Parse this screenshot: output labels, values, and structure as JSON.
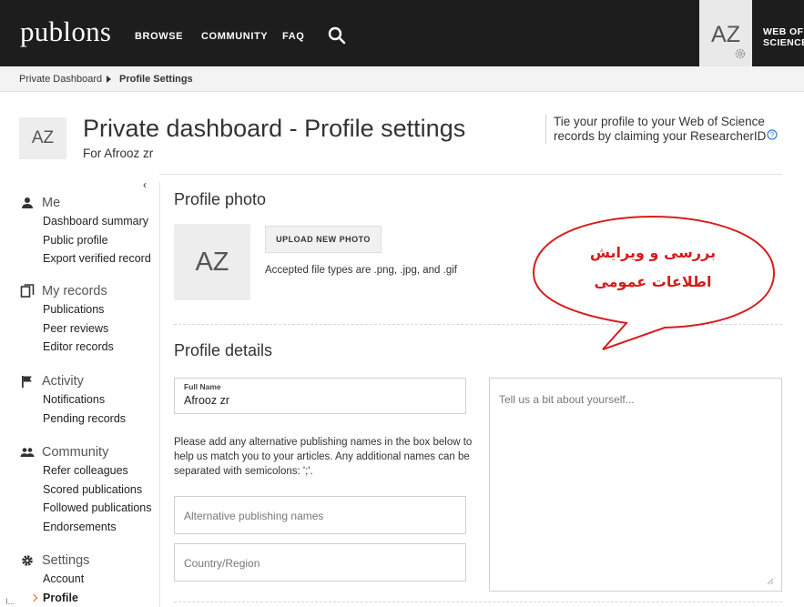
{
  "topbar": {
    "logo": "publons",
    "nav": [
      "BROWSE",
      "COMMUNITY",
      "FAQ"
    ],
    "avatar_initials": "AZ",
    "wos_line1": "WEB OF",
    "wos_line2": "SCIENCE"
  },
  "breadcrumb": [
    "Private Dashboard",
    "Profile Settings"
  ],
  "header": {
    "avatar_initials": "AZ",
    "title": "Private dashboard - Profile settings",
    "subtitle": "For Afrooz zr",
    "claim_text": "Tie your profile to your Web of Science records by claiming your ResearcherID"
  },
  "sidebar": {
    "groups": [
      {
        "title": "Me",
        "icon": "person-icon",
        "items": [
          "Dashboard summary",
          "Public profile",
          "Export verified record"
        ]
      },
      {
        "title": "My records",
        "icon": "records-icon",
        "items": [
          "Publications",
          "Peer reviews",
          "Editor records"
        ]
      },
      {
        "title": "Activity",
        "icon": "flag-icon",
        "items": [
          "Notifications",
          "Pending records"
        ]
      },
      {
        "title": "Community",
        "icon": "people-icon",
        "items": [
          "Refer colleagues",
          "Scored publications",
          "Followed publications",
          "Endorsements"
        ]
      },
      {
        "title": "Settings",
        "icon": "gear-icon",
        "items": [
          "Account",
          "Profile"
        ]
      }
    ],
    "active_item": "Profile",
    "bottom_text": "I..."
  },
  "photo": {
    "section_title": "Profile photo",
    "initials": "AZ",
    "upload_label": "UPLOAD NEW PHOTO",
    "file_types": "Accepted file types are .png, .jpg, and .gif"
  },
  "details": {
    "section_title": "Profile details",
    "full_name_label": "Full Name",
    "full_name_value": "Afrooz zr",
    "alt_help": "Please add any alternative publishing names in the box below to help us match you to your articles. Any additional names can be separated with semicolons: ';'.",
    "alt_placeholder": "Alternative publishing names",
    "country_placeholder": "Country/Region",
    "bio_placeholder": "Tell us a bit about yourself..."
  },
  "annotation": {
    "line1": "بررسی و ویرایش",
    "line2": "اطلاعات عمومی",
    "color": "#d61d1d"
  },
  "colors": {
    "topbar": "#1d1d1d",
    "accent_arrow": "#e0631d"
  }
}
